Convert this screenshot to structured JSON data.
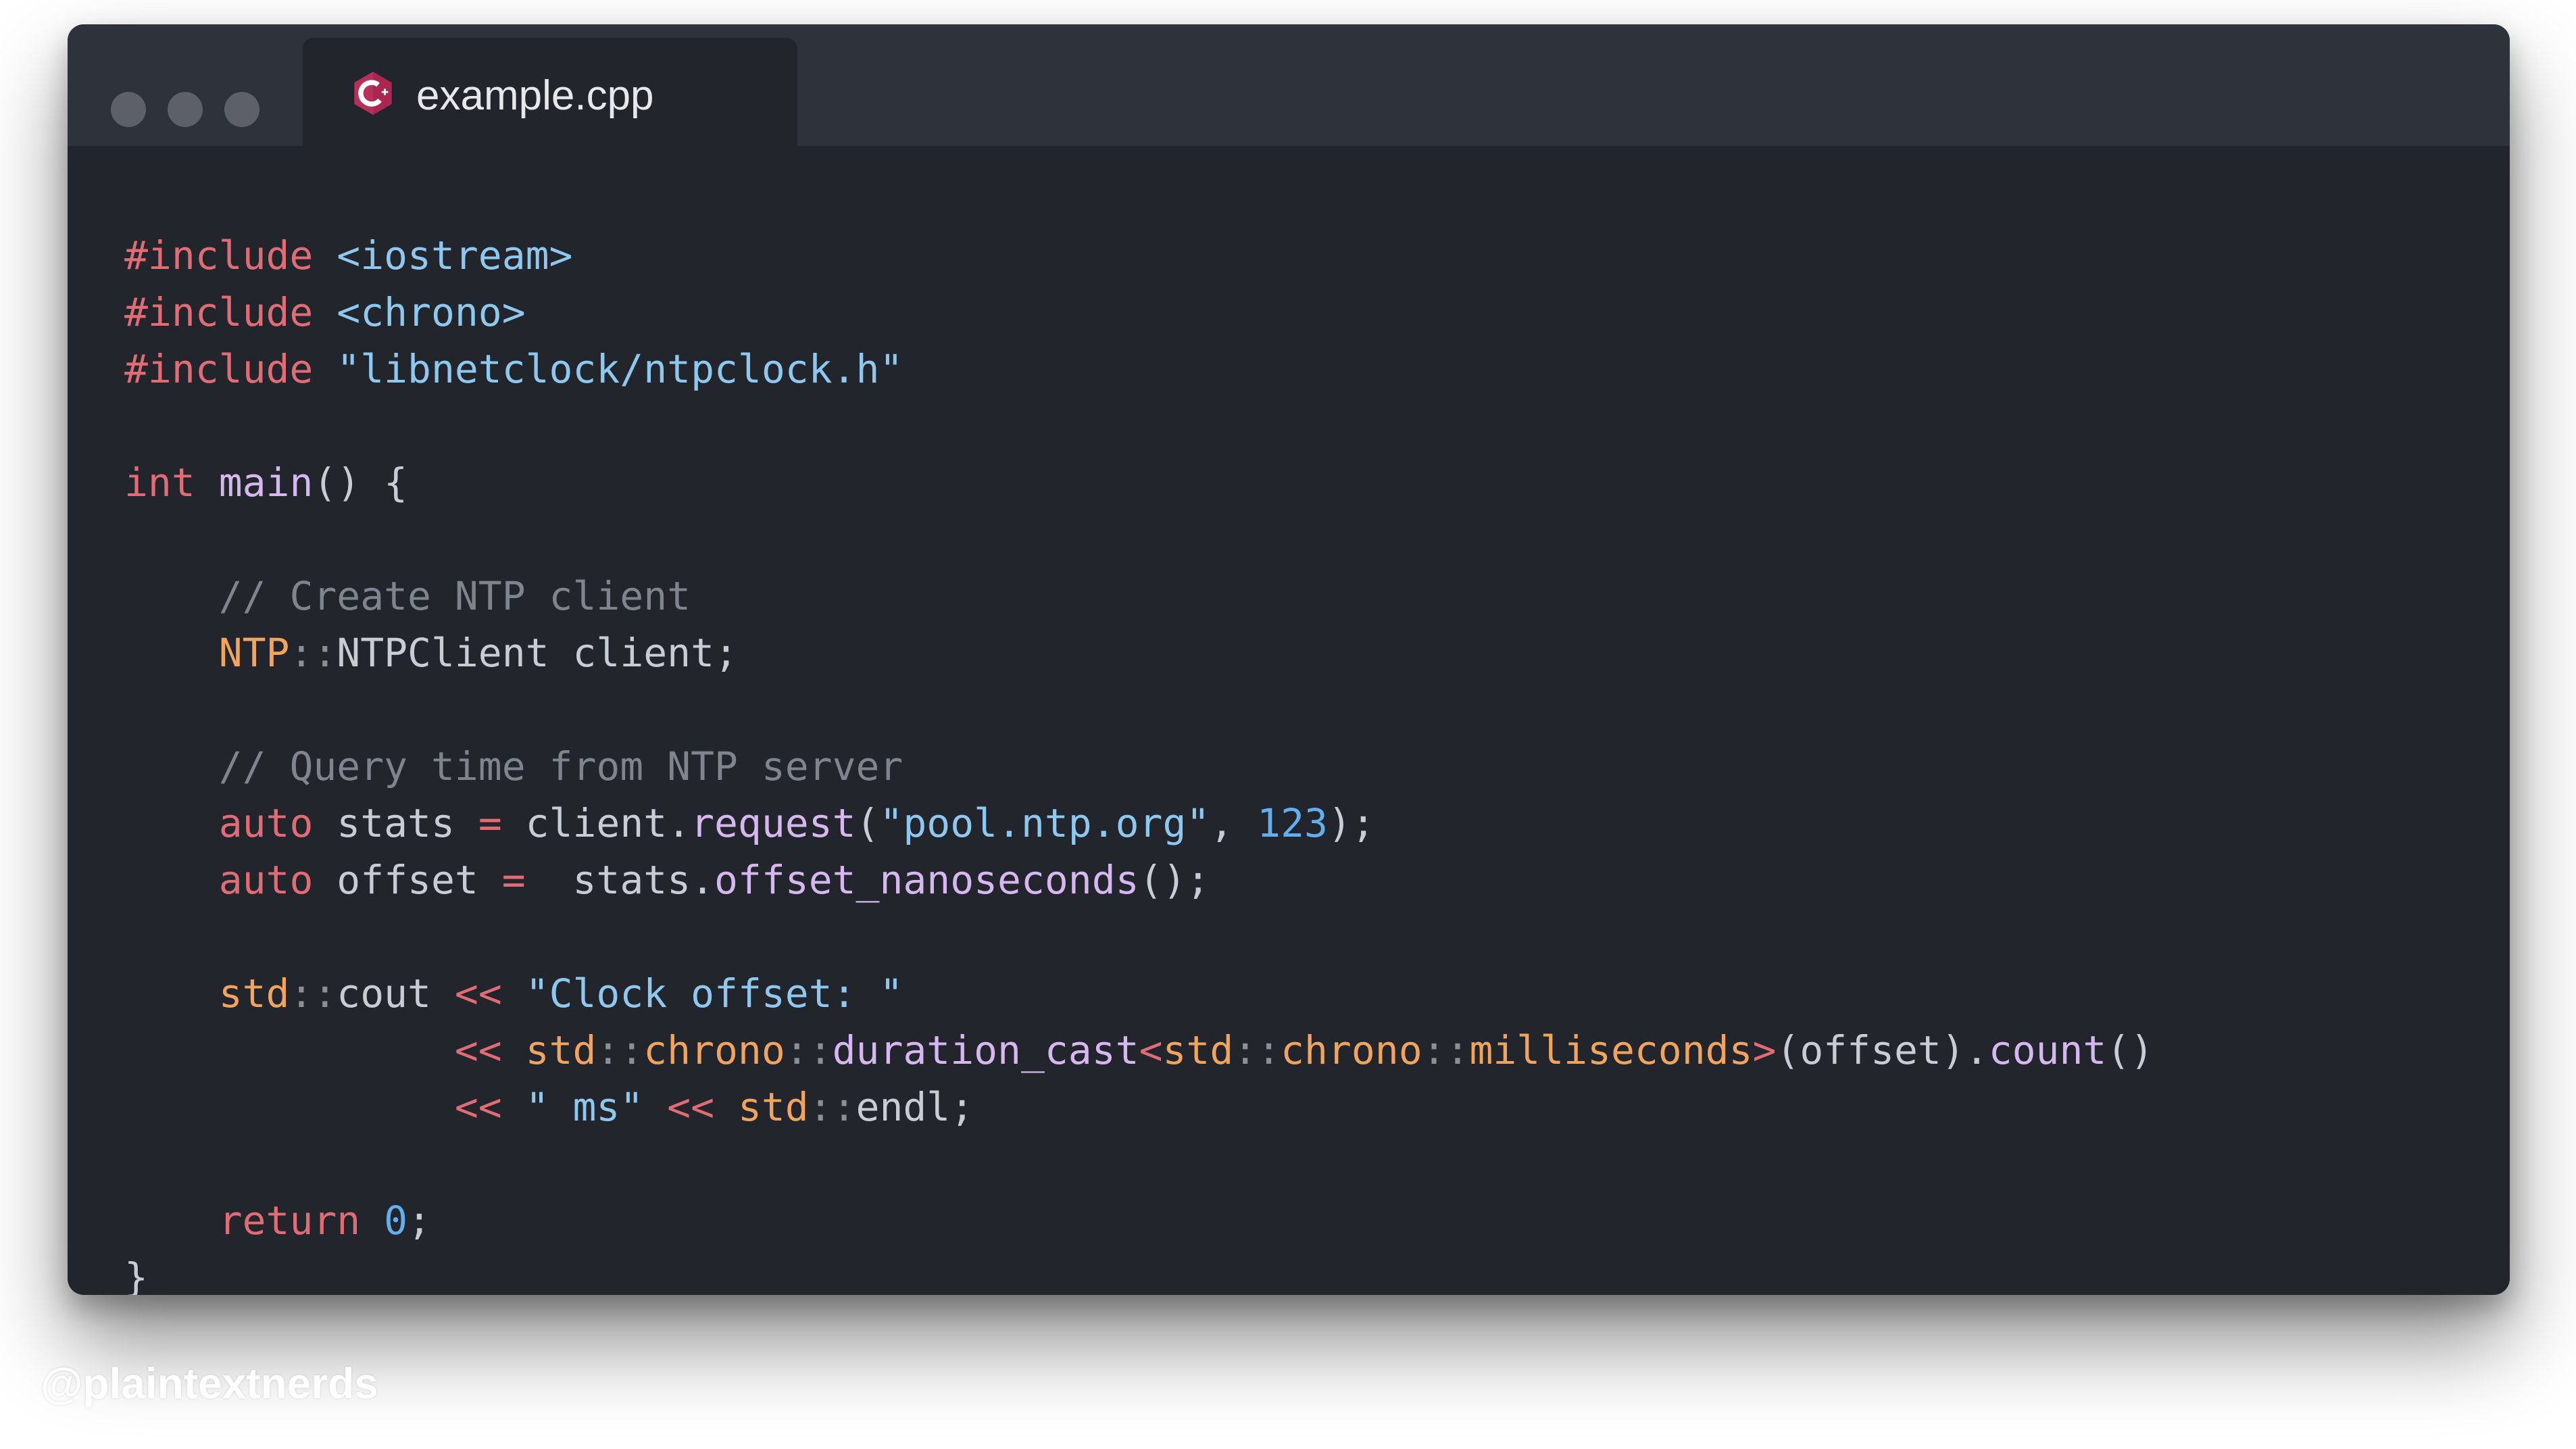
{
  "window": {
    "controls": [
      "close",
      "minimize",
      "zoom"
    ],
    "tab": {
      "icon": "cpp-file-icon",
      "title": "example.cpp"
    }
  },
  "editor": {
    "language": "C++",
    "lines": [
      [
        {
          "t": "pre",
          "v": "#include"
        },
        {
          "t": "ws",
          "v": " "
        },
        {
          "t": "str",
          "v": "<iostream>"
        }
      ],
      [
        {
          "t": "pre",
          "v": "#include"
        },
        {
          "t": "ws",
          "v": " "
        },
        {
          "t": "str",
          "v": "<chrono>"
        }
      ],
      [
        {
          "t": "pre",
          "v": "#include"
        },
        {
          "t": "ws",
          "v": " "
        },
        {
          "t": "str",
          "v": "\"libnetclock/ntpclock.h\""
        }
      ],
      [],
      [
        {
          "t": "kw",
          "v": "int"
        },
        {
          "t": "ws",
          "v": " "
        },
        {
          "t": "fn",
          "v": "main"
        },
        {
          "t": "pun",
          "v": "() {"
        }
      ],
      [],
      [
        {
          "t": "ws",
          "v": "    "
        },
        {
          "t": "cmt",
          "v": "// Create NTP client"
        }
      ],
      [
        {
          "t": "ws",
          "v": "    "
        },
        {
          "t": "ns",
          "v": "NTP"
        },
        {
          "t": "sep",
          "v": "::"
        },
        {
          "t": "id",
          "v": "NTPClient client"
        },
        {
          "t": "pun",
          "v": ";"
        }
      ],
      [],
      [
        {
          "t": "ws",
          "v": "    "
        },
        {
          "t": "cmt",
          "v": "// Query time from NTP server"
        }
      ],
      [
        {
          "t": "ws",
          "v": "    "
        },
        {
          "t": "kw",
          "v": "auto"
        },
        {
          "t": "id",
          "v": " stats "
        },
        {
          "t": "op",
          "v": "="
        },
        {
          "t": "id",
          "v": " client."
        },
        {
          "t": "fn",
          "v": "request"
        },
        {
          "t": "pun",
          "v": "("
        },
        {
          "t": "str",
          "v": "\"pool.ntp.org\""
        },
        {
          "t": "pun",
          "v": ", "
        },
        {
          "t": "num",
          "v": "123"
        },
        {
          "t": "pun",
          "v": ");"
        }
      ],
      [
        {
          "t": "ws",
          "v": "    "
        },
        {
          "t": "kw",
          "v": "auto"
        },
        {
          "t": "id",
          "v": " offset "
        },
        {
          "t": "op",
          "v": "="
        },
        {
          "t": "id",
          "v": "  stats."
        },
        {
          "t": "fn",
          "v": "offset_nanoseconds"
        },
        {
          "t": "pun",
          "v": "();"
        }
      ],
      [],
      [
        {
          "t": "ws",
          "v": "    "
        },
        {
          "t": "ns",
          "v": "std"
        },
        {
          "t": "sep",
          "v": "::"
        },
        {
          "t": "id",
          "v": "cout "
        },
        {
          "t": "op",
          "v": "<<"
        },
        {
          "t": "ws",
          "v": " "
        },
        {
          "t": "str",
          "v": "\"Clock offset: \""
        }
      ],
      [
        {
          "t": "ws",
          "v": "              "
        },
        {
          "t": "op",
          "v": "<<"
        },
        {
          "t": "ws",
          "v": " "
        },
        {
          "t": "ns",
          "v": "std"
        },
        {
          "t": "sep",
          "v": "::"
        },
        {
          "t": "ns",
          "v": "chrono"
        },
        {
          "t": "sep",
          "v": "::"
        },
        {
          "t": "fn",
          "v": "duration_cast"
        },
        {
          "t": "op",
          "v": "<"
        },
        {
          "t": "ns",
          "v": "std"
        },
        {
          "t": "sep",
          "v": "::"
        },
        {
          "t": "ns",
          "v": "chrono"
        },
        {
          "t": "sep",
          "v": "::"
        },
        {
          "t": "ns",
          "v": "milliseconds"
        },
        {
          "t": "op",
          "v": ">"
        },
        {
          "t": "pun",
          "v": "(offset)."
        },
        {
          "t": "fn",
          "v": "count"
        },
        {
          "t": "pun",
          "v": "()"
        }
      ],
      [
        {
          "t": "ws",
          "v": "              "
        },
        {
          "t": "op",
          "v": "<<"
        },
        {
          "t": "ws",
          "v": " "
        },
        {
          "t": "str",
          "v": "\" ms\""
        },
        {
          "t": "ws",
          "v": " "
        },
        {
          "t": "op",
          "v": "<<"
        },
        {
          "t": "ws",
          "v": " "
        },
        {
          "t": "ns",
          "v": "std"
        },
        {
          "t": "sep",
          "v": "::"
        },
        {
          "t": "id",
          "v": "endl"
        },
        {
          "t": "pun",
          "v": ";"
        }
      ],
      [],
      [
        {
          "t": "ws",
          "v": "    "
        },
        {
          "t": "kw",
          "v": "return"
        },
        {
          "t": "ws",
          "v": " "
        },
        {
          "t": "num",
          "v": "0"
        },
        {
          "t": "pun",
          "v": ";"
        }
      ],
      [
        {
          "t": "pun",
          "v": "}"
        }
      ]
    ]
  },
  "watermark": "@plaintextnerds",
  "colors": {
    "background": "#22252c",
    "titlebar": "#2e323a",
    "preprocessor": "#e06c75",
    "keyword": "#e06c75",
    "string": "#8ec8ef",
    "comment": "#7f848e",
    "namespace": "#f0a45d",
    "function": "#d7b7ef",
    "number": "#61afef",
    "text": "#c8ccd4",
    "cpp_icon": "#b8305a"
  }
}
